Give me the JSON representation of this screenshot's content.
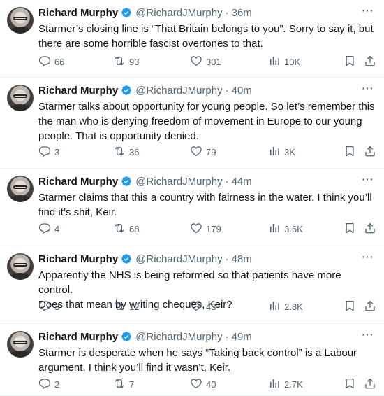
{
  "author": {
    "name": "Richard Murphy",
    "handle": "@RichardJMurphy",
    "separator": "·"
  },
  "colors": {
    "verified": "#1d9bf0",
    "muted": "#536471",
    "text": "#0f1419",
    "divider": "#eff3f4"
  },
  "icons": [
    "verified-badge-icon",
    "more-icon",
    "reply-icon",
    "retweet-icon",
    "like-icon",
    "views-icon",
    "bookmark-icon",
    "share-icon"
  ],
  "tweets": [
    {
      "time": "36m",
      "lines": [
        "Starmer’s closing line is “That Britain belongs to you”. Sorry to say it, but",
        "there are some horrible fascist overtones to that."
      ],
      "replies": "66",
      "retweets": "93",
      "likes": "301",
      "views": "10K"
    },
    {
      "time": "40m",
      "lines": [
        "Starmer talks about opportunity for young people. So let’s remember this",
        "the man who is denying freedom of movement in Europe to our young",
        "people. That is opportunity denied."
      ],
      "replies": "3",
      "retweets": "36",
      "likes": "79",
      "views": "3K"
    },
    {
      "time": "44m",
      "lines": [
        "Starmer claims that this a country with fairness in the water. I think you’ll",
        "find it’s shit, Keir."
      ],
      "replies": "4",
      "retweets": "68",
      "likes": "179",
      "views": "3.6K"
    },
    {
      "time": "48m",
      "lines": [
        "Apparently the NHS is being reformed so that patients have more control.",
        "Does that mean by writing cheques, Keir?"
      ],
      "replies": "3",
      "retweets": "12",
      "likes": "43",
      "views": "2.8K"
    },
    {
      "time": "49m",
      "lines": [
        "Starmer is desperate when he says “Taking back control” is a Labour",
        "argument. I think you’ll find it wasn’t, Keir."
      ],
      "replies": "2",
      "retweets": "7",
      "likes": "40",
      "views": "2.7K"
    }
  ]
}
